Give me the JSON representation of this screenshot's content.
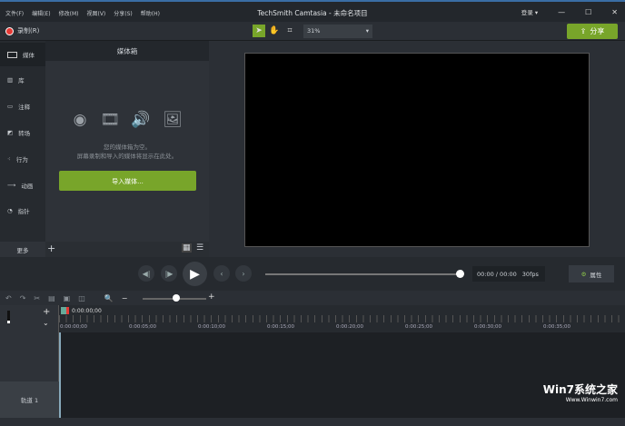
{
  "titlebar": {
    "menu": [
      "文件(F)",
      "编辑(E)",
      "修改(M)",
      "视图(V)",
      "分享(S)",
      "帮助(H)"
    ],
    "title": "TechSmith Camtasia - 未命名项目",
    "login": "登录 ▾",
    "minimize": "—",
    "maximize": "☐",
    "close": "✕"
  },
  "toolbar": {
    "record": "录制(R)",
    "zoom": "31%",
    "share": "分享"
  },
  "sidebar": {
    "items": [
      "媒体",
      "库",
      "注释",
      "转场",
      "行为",
      "动画",
      "指针"
    ],
    "more": "更多",
    "add": "+"
  },
  "media": {
    "title": "媒体箱",
    "empty_line1": "您的媒体箱为空。",
    "empty_line2": "屏幕录制和导入的媒体将显示在此处。",
    "import": "导入媒体..."
  },
  "playback": {
    "time": "00:00 / 00:00",
    "fps": "30fps",
    "properties": "属性",
    "progress": 1.0
  },
  "timeline": {
    "playhead": "0:00:00;00",
    "ticks": [
      "0:00:00;00",
      "0:00:05;00",
      "0:00:10;00",
      "0:00:15;00",
      "0:00:20;00",
      "0:00:25;00",
      "0:00:30;00",
      "0:00:35;00"
    ],
    "track": "轨道 1",
    "zoom_level": 0.55
  },
  "watermark": {
    "brand": "Win7系统之家",
    "url": "Www.Winwin7.com"
  }
}
